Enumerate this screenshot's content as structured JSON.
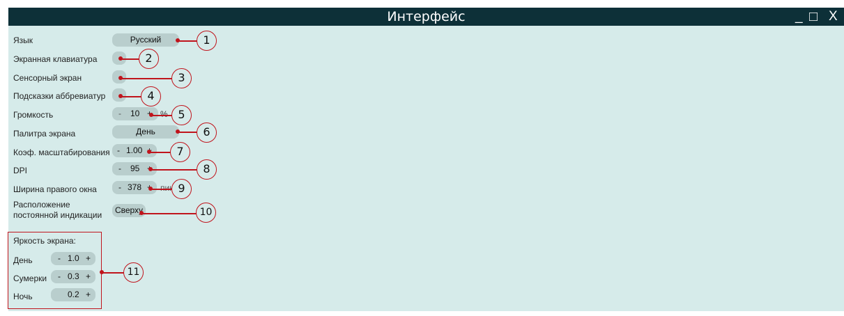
{
  "window": {
    "title": "Интерфейс",
    "minimize": "_",
    "maximize": "□",
    "close": "X"
  },
  "settings": {
    "language": {
      "label": "Язык",
      "value": "Русский",
      "callout": "1"
    },
    "osk": {
      "label": "Экранная клавиатура",
      "callout": "2"
    },
    "touch": {
      "label": "Сенсорный экран",
      "callout": "3"
    },
    "abbrev": {
      "label": "Подсказки аббревиатур",
      "callout": "4"
    },
    "volume": {
      "label": "Громкость",
      "minus": "-",
      "value": "10",
      "plus": "+",
      "unit": "%",
      "callout": "5"
    },
    "palette": {
      "label": "Палитра экрана",
      "value": "День",
      "callout": "6"
    },
    "scale": {
      "label": "Коэф. масштабирования",
      "minus": "-",
      "value": "1.00",
      "plus": "+",
      "callout": "7"
    },
    "dpi": {
      "label": "DPI",
      "minus": "-",
      "value": "95",
      "plus": "+",
      "callout": "8"
    },
    "right_width": {
      "label": "Ширина правого окна",
      "minus": "-",
      "value": "378",
      "plus": "+",
      "unit": "пикс",
      "callout": "9"
    },
    "indication": {
      "label_line1": "Расположение",
      "label_line2": "постоянной индикации",
      "value": "Сверху",
      "callout": "10"
    }
  },
  "brightness": {
    "title": "Яркость экрана:",
    "day": {
      "label": "День",
      "minus": "-",
      "value": "1.0",
      "plus": "+"
    },
    "dusk": {
      "label": "Сумерки",
      "minus": "-",
      "value": "0.3",
      "plus": "+"
    },
    "night": {
      "label": "Ночь",
      "value": "0.2",
      "plus": "+"
    },
    "callout": "11"
  },
  "colors": {
    "titlebar": "#0d3038",
    "panel": "#d6ebea",
    "control": "#b9cecd",
    "callout": "#c0141c"
  }
}
